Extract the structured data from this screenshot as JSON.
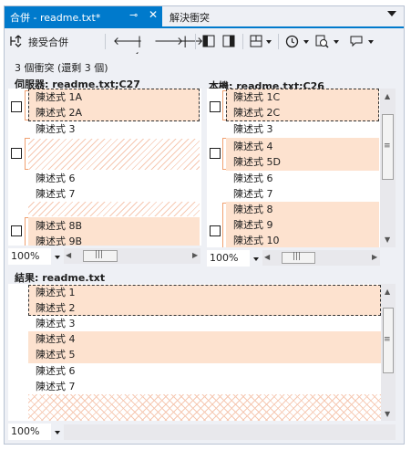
{
  "tabs": {
    "active_title": "合併 - readme.txt*",
    "pin_glyph": "⊸",
    "close_glyph": "✕",
    "inactive_title": "解決衝突"
  },
  "toolbar": {
    "accept_merge_label": "接受合併"
  },
  "status": {
    "conflict_summary": "3 個衝突 (還剩 3 個)"
  },
  "server_pane": {
    "header": "伺服器: readme.txt;C27",
    "rows": [
      "陳述式 1A",
      "陳述式 2A",
      "陳述式 3",
      "陳述式 6",
      "陳述式 7",
      "陳述式 8B",
      "陳述式 9B"
    ],
    "zoom": "100%"
  },
  "local_pane": {
    "header": "本機: readme.txt;C26",
    "rows": [
      "陳述式 1C",
      "陳述式 2C",
      "陳述式 3",
      "陳述式 4",
      "陳述式 5D",
      "陳述式 6",
      "陳述式 7",
      "陳述式 8",
      "陳述式 9",
      "陳述式 10"
    ],
    "zoom": "100%"
  },
  "result_pane": {
    "header": "結果: readme.txt",
    "rows": [
      "陳述式 1",
      "陳述式 2",
      "陳述式 3",
      "陳述式 4",
      "陳述式 5",
      "陳述式 6",
      "陳述式 7"
    ],
    "zoom": "100%"
  },
  "colors": {
    "accent": "#007acc",
    "conflict_highlight": "#fde2cf",
    "hatch": "#f6c9b3",
    "chrome": "#eef0f5"
  }
}
